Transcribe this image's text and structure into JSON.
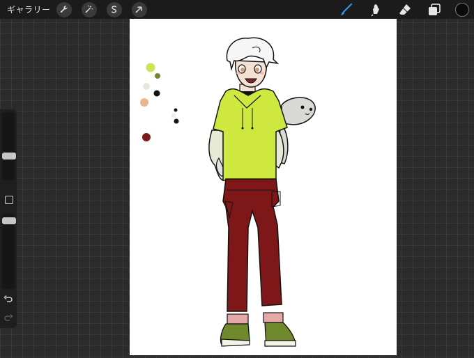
{
  "toolbar": {
    "gallery_label": "ギャラリー",
    "left_tools": [
      {
        "name": "actions",
        "icon": "wrench-icon"
      },
      {
        "name": "adjustments",
        "icon": "magic-wand-icon"
      },
      {
        "name": "selection",
        "icon": "selection-s-icon"
      },
      {
        "name": "transform",
        "icon": "arrow-cursor-icon"
      }
    ],
    "right_tools": [
      {
        "name": "brush",
        "icon": "brush-icon",
        "active": true
      },
      {
        "name": "smudge",
        "icon": "smudge-icon",
        "active": false
      },
      {
        "name": "eraser",
        "icon": "eraser-icon",
        "active": false
      },
      {
        "name": "layers",
        "icon": "layers-icon",
        "active": false
      }
    ],
    "current_color": "#0a0a0a",
    "active_tool_color": "#3b8fe8"
  },
  "sidebar": {
    "size_slider_icon": "size-slider-icon",
    "modify_button_icon": "square-icon",
    "opacity_slider_icon": "opacity-slider-icon",
    "undo_icon": "undo-icon",
    "redo_icon": "redo-icon"
  },
  "canvas": {
    "background": "#ffffff",
    "palette_dots": [
      "#cfe25a",
      "#6e8a2f",
      "#e6e6dc",
      "#111111",
      "#e8b68f",
      "#111111",
      "#eeeeee",
      "#111111",
      "#7a1c1c"
    ],
    "illustration": {
      "hoodie_color": "#cfe83f",
      "pants_color": "#7e1717",
      "shoe_color": "#6f8a2c",
      "sock_color": "#e6a9a9",
      "hair_color": "#f6f6f6",
      "skin_color": "#f6e2d3",
      "seal_color": "#d9dad6"
    }
  }
}
